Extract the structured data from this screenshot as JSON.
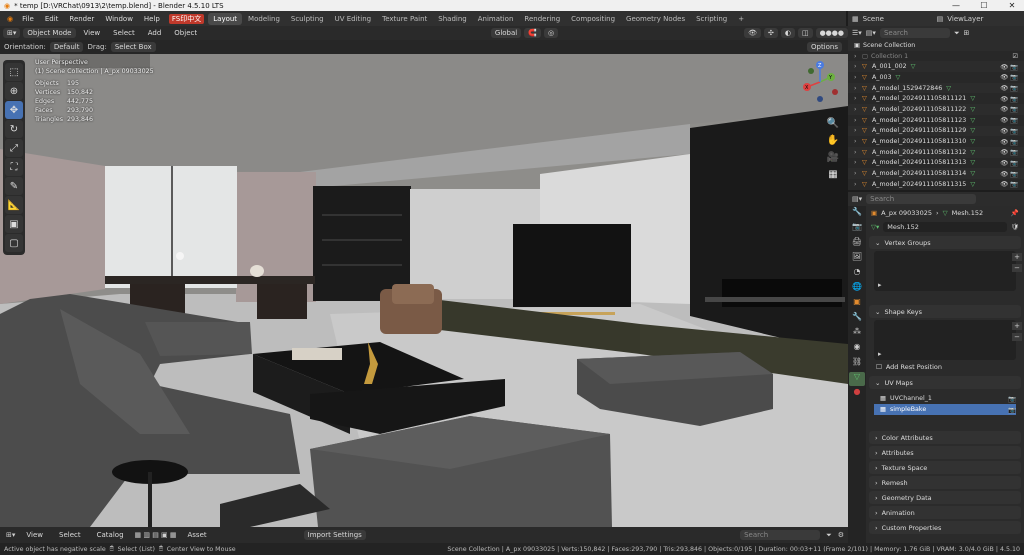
{
  "window": {
    "title": "* temp [D:\\VRChat\\0913\\2\\temp.blend] - Blender 4.5.10 LTS"
  },
  "menu": [
    "File",
    "Edit",
    "Render",
    "Window",
    "Help"
  ],
  "lang_badge": "FS印中文",
  "workspaces": [
    "Layout",
    "Modeling",
    "Sculpting",
    "UV Editing",
    "Texture Paint",
    "Shading",
    "Animation",
    "Rendering",
    "Compositing",
    "Geometry Nodes",
    "Scripting"
  ],
  "workspace_add": "+",
  "viewport_header": {
    "mode": "Object Mode",
    "menus": [
      "View",
      "Select",
      "Add",
      "Object"
    ],
    "orientation_label": "Orientation:",
    "orientation_value": "Default",
    "drag_label": "Drag:",
    "drag_value": "Select Box",
    "transform": "Global",
    "options": "Options"
  },
  "overlay": {
    "perspective": "User Perspective",
    "collection": "(1) Scene Collection | A_px 09033025",
    "stats": [
      [
        "Objects",
        "195"
      ],
      [
        "Vertices",
        "150,842"
      ],
      [
        "Edges",
        "442,775"
      ],
      [
        "Faces",
        "293,790"
      ],
      [
        "Triangles",
        "293,846"
      ]
    ]
  },
  "gizmo": {
    "x": "X",
    "y": "Y",
    "z": "Z"
  },
  "bottom": {
    "menus": [
      "View",
      "Select",
      "Catalog"
    ],
    "asset": "Asset",
    "import": "Import Settings",
    "search_placeholder": "Search"
  },
  "statusbar": {
    "left": "Active object has negative scale",
    "select": "Select (List)",
    "center": "Center View to Mouse",
    "right": "Scene Collection | A_px 09033025 | Verts:150,842 | Faces:293,790 | Tris:293,846 | Objects:0/195 | Duration: 00:03+11 (Frame 2/101) | Memory: 1.76 GiB | VRAM: 3.0/4.0 GiB | 4.5.10"
  },
  "outliner": {
    "scene": "Scene",
    "view_layer": "ViewLayer",
    "search_placeholder": "Search",
    "root": "Scene Collection",
    "items": [
      "Collection 1",
      "A_001_002",
      "A_003",
      "A_model_1529472846",
      "A_model_2024911105811121",
      "A_model_2024911105811122",
      "A_model_2024911105811123",
      "A_model_2024911105811129",
      "A_model_2024911105811310",
      "A_model_2024911105811312",
      "A_model_2024911105811313",
      "A_model_2024911105811314",
      "A_model_2024911105811315"
    ]
  },
  "props": {
    "search_placeholder": "Search",
    "object": "A_px 09033025",
    "mesh": "Mesh.152",
    "mesh_field": "Mesh.152",
    "sections": {
      "vertex_groups": "Vertex Groups",
      "shape_keys": "Shape Keys",
      "add_rest": "Add Rest Position",
      "uv_maps": "UV Maps"
    },
    "uv": [
      "UVChannel_1",
      "simpleBake"
    ],
    "collapsed": [
      "Color Attributes",
      "Attributes",
      "Texture Space",
      "Remesh",
      "Geometry Data",
      "Animation",
      "Custom Properties"
    ]
  }
}
